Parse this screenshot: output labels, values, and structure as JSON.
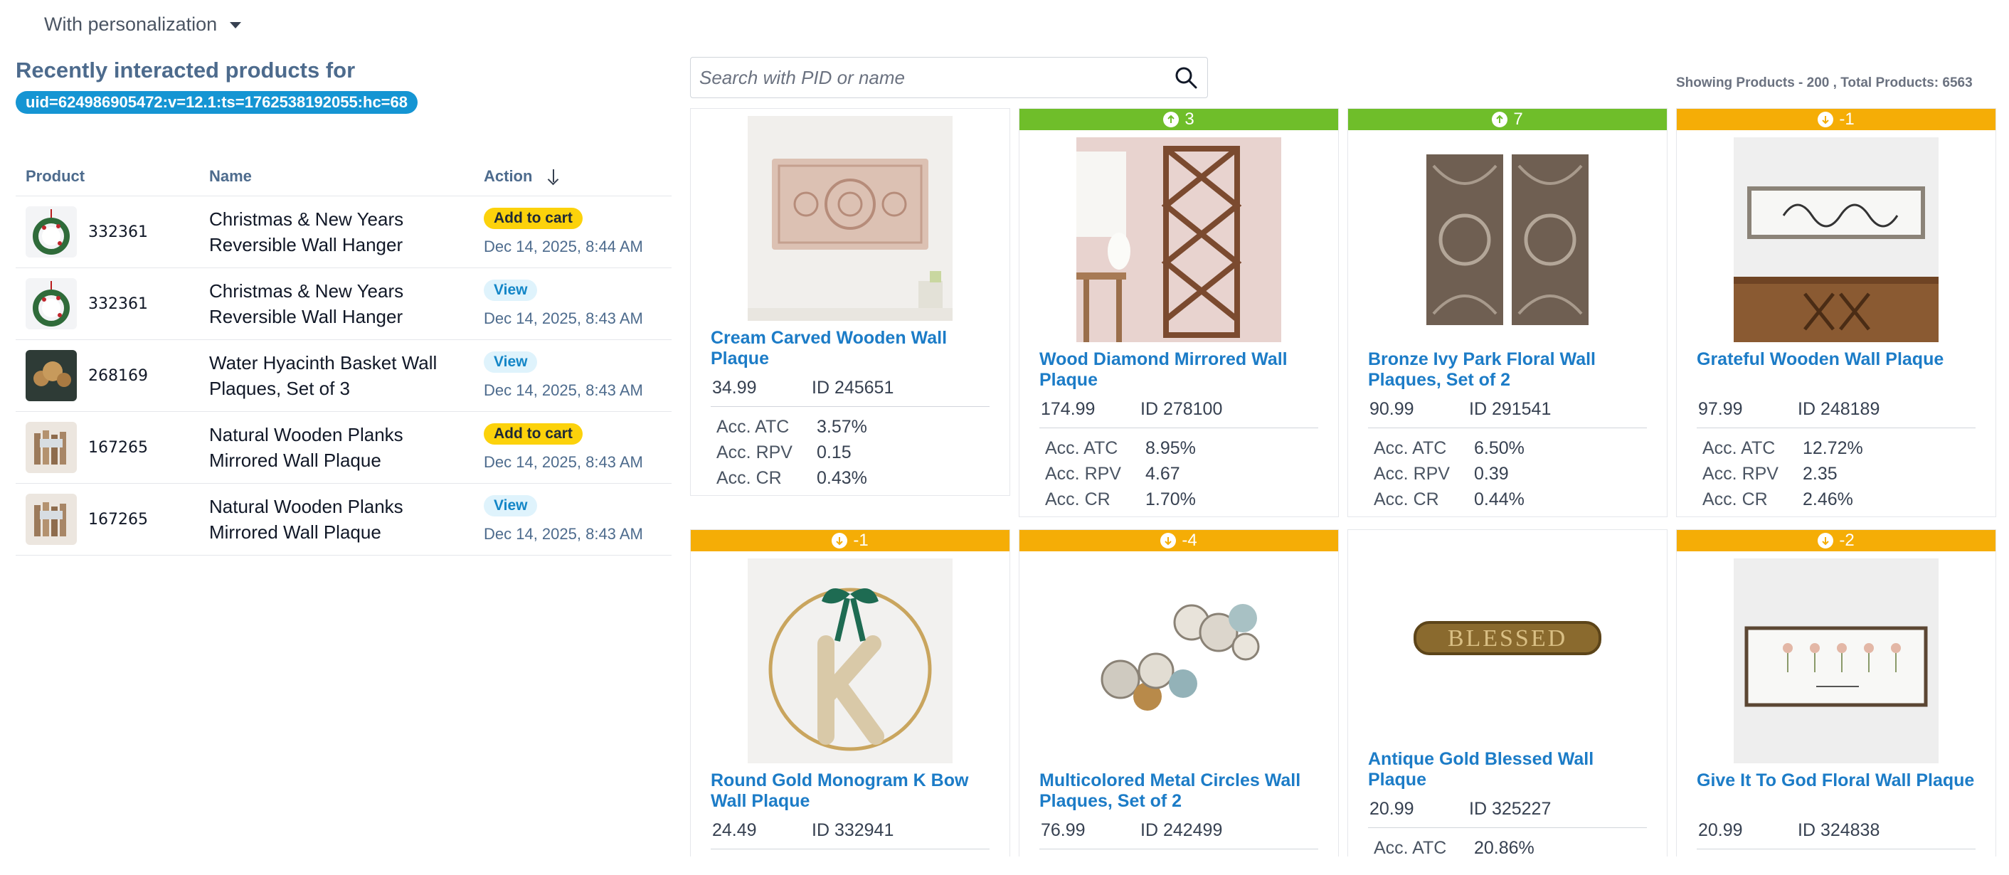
{
  "mode": {
    "label": "With personalization"
  },
  "left": {
    "title": "Recently interacted products for",
    "uid": "uid=624986905472:v=12.1:ts=1762538192055:hc=68",
    "headers": {
      "product": "Product",
      "name": "Name",
      "action": "Action"
    },
    "rows": [
      {
        "pid": "332361",
        "name": "Christmas & New Years Reversible Wall Hanger",
        "action": "Add to cart",
        "action_type": "cart",
        "time": "Dec 14, 2025, 8:44 AM"
      },
      {
        "pid": "332361",
        "name": "Christmas & New Years Reversible Wall Hanger",
        "action": "View",
        "action_type": "view",
        "time": "Dec 14, 2025, 8:43 AM"
      },
      {
        "pid": "268169",
        "name": "Water Hyacinth Basket Wall Plaques, Set of 3",
        "action": "View",
        "action_type": "view",
        "time": "Dec 14, 2025, 8:43 AM"
      },
      {
        "pid": "167265",
        "name": "Natural Wooden Planks Mirrored Wall Plaque",
        "action": "Add to cart",
        "action_type": "cart",
        "time": "Dec 14, 2025, 8:43 AM"
      },
      {
        "pid": "167265",
        "name": "Natural Wooden Planks Mirrored Wall Plaque",
        "action": "View",
        "action_type": "view",
        "time": "Dec 14, 2025, 8:43 AM"
      }
    ]
  },
  "search": {
    "placeholder": "Search with PID or name"
  },
  "showing": "Showing Products - 200 , Total Products: 6563",
  "metric_labels": {
    "atc": "Acc. ATC",
    "rpv": "Acc. RPV",
    "cr": "Acc. CR"
  },
  "products": [
    {
      "title": "Cream Carved Wooden Wall Plaque",
      "price": "34.99",
      "id": "ID 245651",
      "rank": "",
      "direction": "none",
      "atc": "3.57%",
      "rpv": "0.15",
      "cr": "0.43%"
    },
    {
      "title": "Wood Diamond Mirrored Wall Plaque",
      "price": "174.99",
      "id": "ID 278100",
      "rank": "3",
      "direction": "up",
      "atc": "8.95%",
      "rpv": "4.67",
      "cr": "1.70%"
    },
    {
      "title": "Bronze Ivy Park Floral Wall Plaques, Set of 2",
      "price": "90.99",
      "id": "ID 291541",
      "rank": "7",
      "direction": "up",
      "atc": "6.50%",
      "rpv": "0.39",
      "cr": "0.44%"
    },
    {
      "title": "Grateful Wooden Wall Plaque",
      "price": "97.99",
      "id": "ID 248189",
      "rank": "-1",
      "direction": "down",
      "atc": "12.72%",
      "rpv": "2.35",
      "cr": "2.46%"
    },
    {
      "title": "Round Gold Monogram K Bow Wall Plaque",
      "price": "24.49",
      "id": "ID 332941",
      "rank": "-1",
      "direction": "down"
    },
    {
      "title": "Multicolored Metal Circles Wall Plaques, Set of 2",
      "price": "76.99",
      "id": "ID 242499",
      "rank": "-4",
      "direction": "down"
    },
    {
      "title": "Antique Gold Blessed Wall Plaque",
      "price": "20.99",
      "id": "ID 325227",
      "rank": "",
      "direction": "none",
      "atc": "20.86%"
    },
    {
      "title": "Give It To God Floral Wall Plaque",
      "price": "20.99",
      "id": "ID 324838",
      "rank": "-2",
      "direction": "down"
    }
  ],
  "colors": {
    "up": "#6fbe2a",
    "down": "#f5ad06",
    "link": "#1c7cc7",
    "uid_pill": "#1595d3"
  }
}
